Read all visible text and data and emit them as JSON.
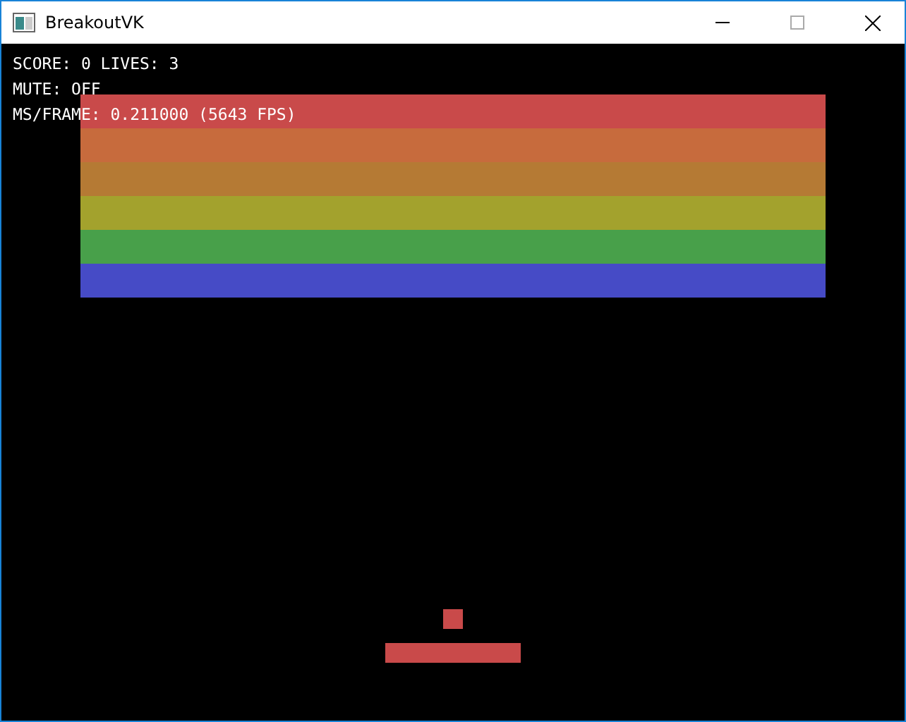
{
  "window": {
    "title": "BreakoutVK"
  },
  "hud": [
    "SCORE: 0 LIVES: 3",
    "MUTE: OFF",
    "MS/FRAME: 0.211000 (5643 FPS)"
  ],
  "brick_rows": [
    {
      "color": "#c94a4a"
    },
    {
      "color": "#c76b3d"
    },
    {
      "color": "#b57a34"
    },
    {
      "color": "#a3a22d"
    },
    {
      "color": "#48a04a"
    },
    {
      "color": "#464bc6"
    }
  ]
}
